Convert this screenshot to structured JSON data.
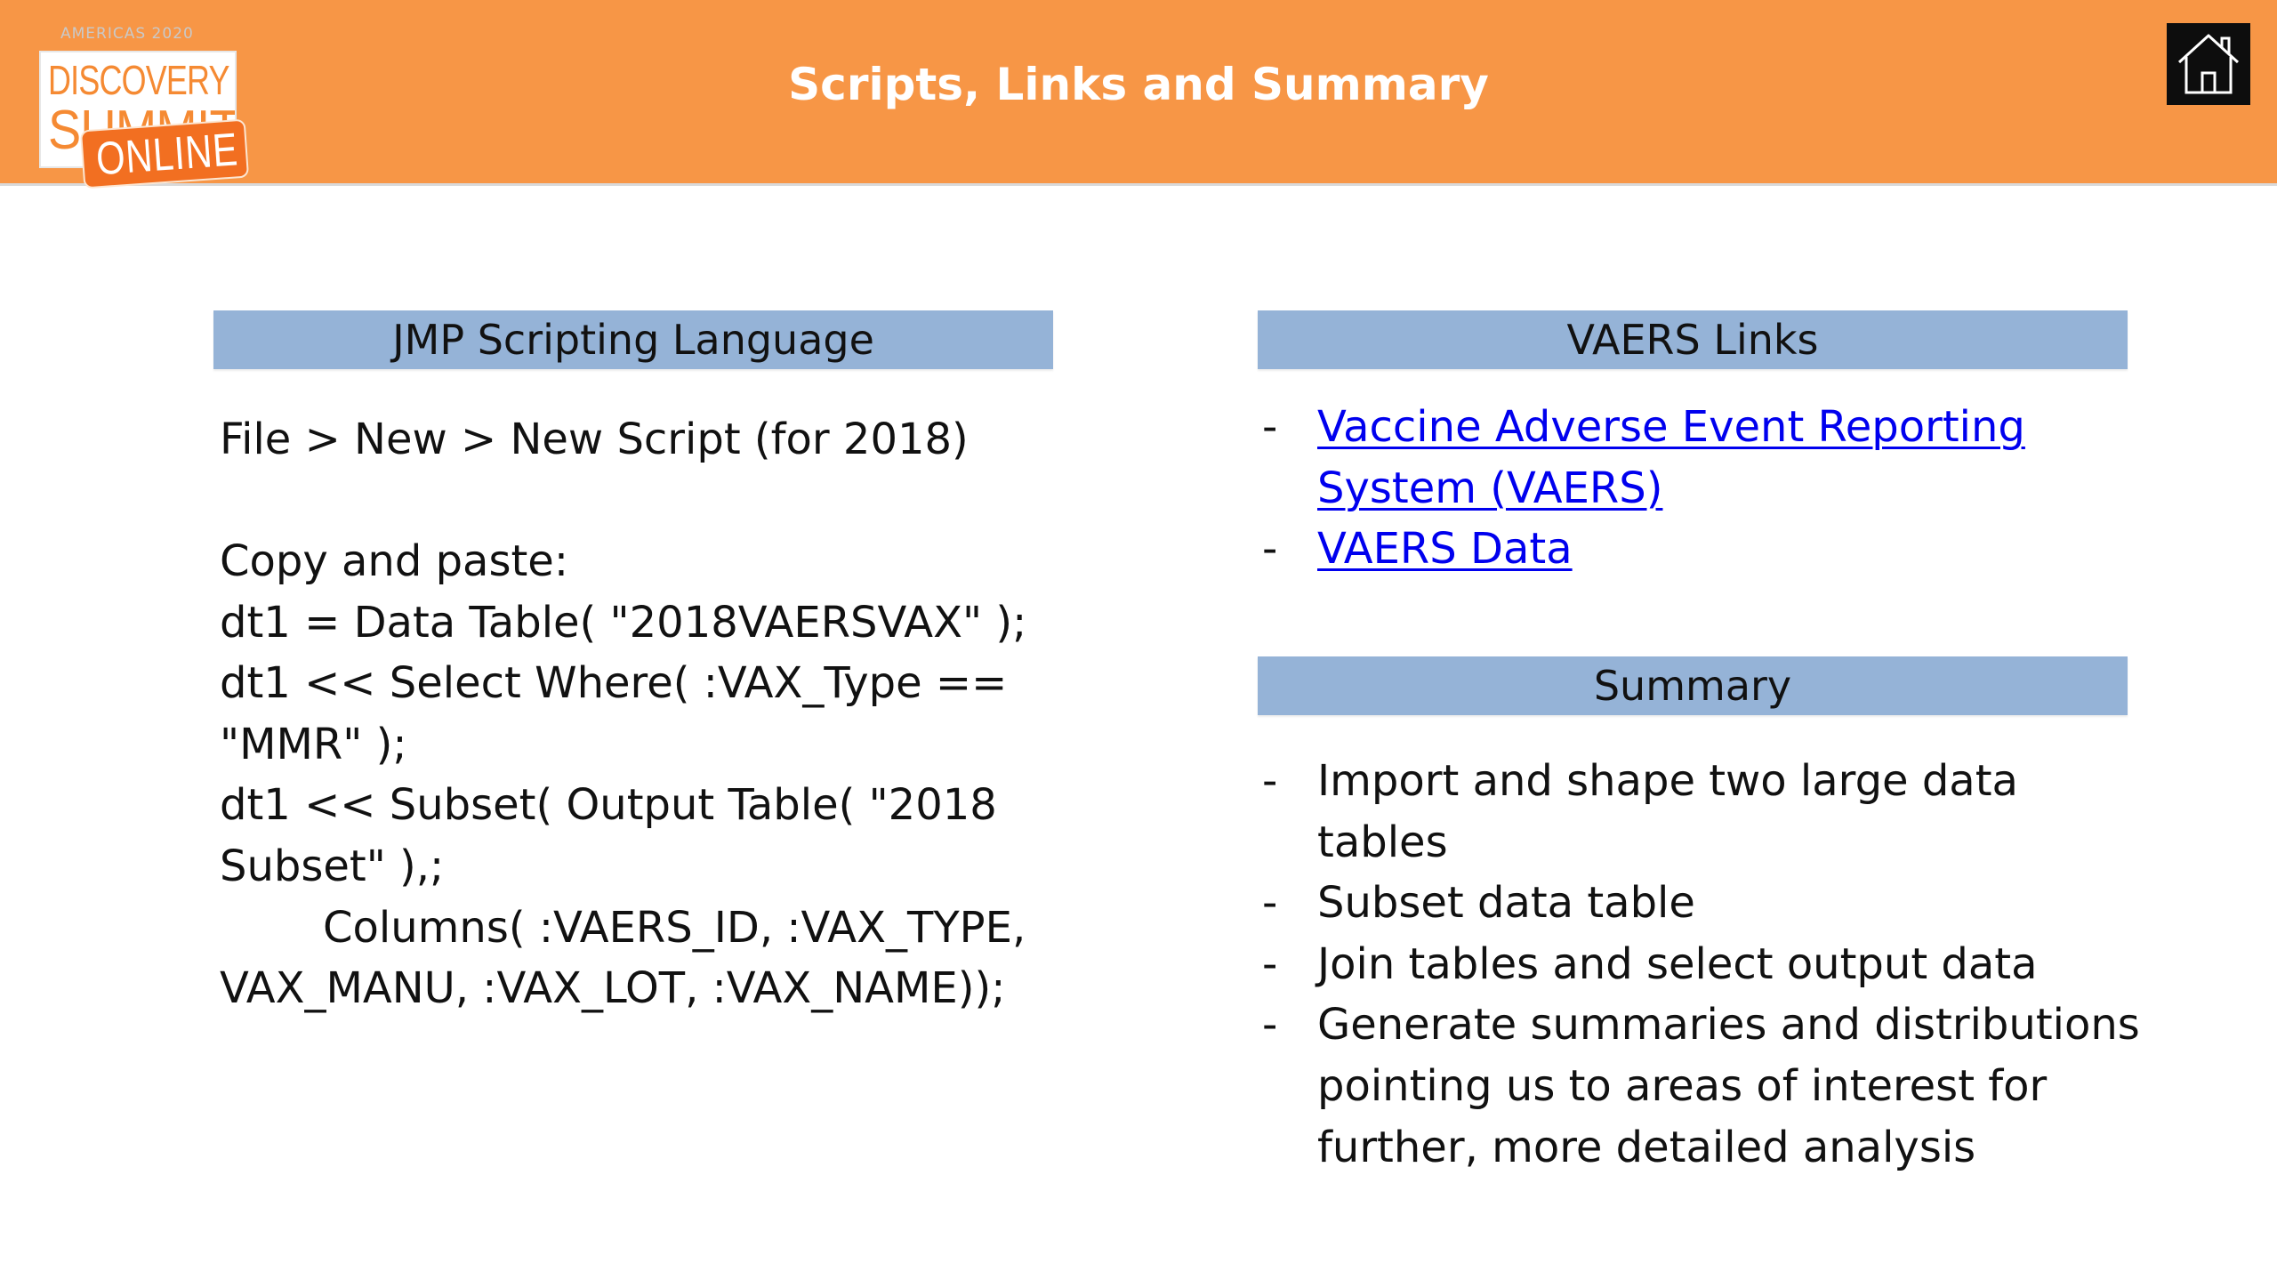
{
  "header": {
    "logo": {
      "supertitle": "AMERICAS 2020",
      "line1": "DISCOVERY",
      "line2": "SUMMIT",
      "badge": "ONLINE"
    },
    "title": "Scripts, Links and Summary",
    "home_icon": "home-icon"
  },
  "left": {
    "section_title": "JMP Scripting Language",
    "menu_path": "File > New > New Script (for 2018)",
    "script_lines": [
      "Copy and paste:",
      "dt1 = Data Table( \"2018VAERSVAX\" );",
      "dt1 << Select Where( :VAX_Type ==",
      "\"MMR\" );",
      "dt1 << Subset( Output Table( \"2018",
      "Subset\" ),;",
      "Columns( :VAERS_ID, :VAX_TYPE,",
      "VAX_MANU, :VAX_LOT, :VAX_NAME));"
    ]
  },
  "links": {
    "section_title": "VAERS Links",
    "bullet": "-",
    "items": [
      {
        "line1": "Vaccine Adverse Event Reporting",
        "line2": "System (VAERS)"
      },
      {
        "line1": "VAERS Data"
      }
    ]
  },
  "summary": {
    "section_title": "Summary",
    "bullet": "-",
    "items": [
      {
        "lines": [
          "Import and shape two large data",
          "tables"
        ]
      },
      {
        "lines": [
          "Subset data table"
        ]
      },
      {
        "lines": [
          "Join tables and select output data"
        ]
      },
      {
        "lines": [
          "Generate summaries and distributions",
          "pointing us to areas of interest for",
          "further, more detailed analysis"
        ]
      }
    ]
  },
  "colors": {
    "header_bg": "#f79646",
    "section_bar_bg": "#95b3d7",
    "link": "#0000ee"
  }
}
